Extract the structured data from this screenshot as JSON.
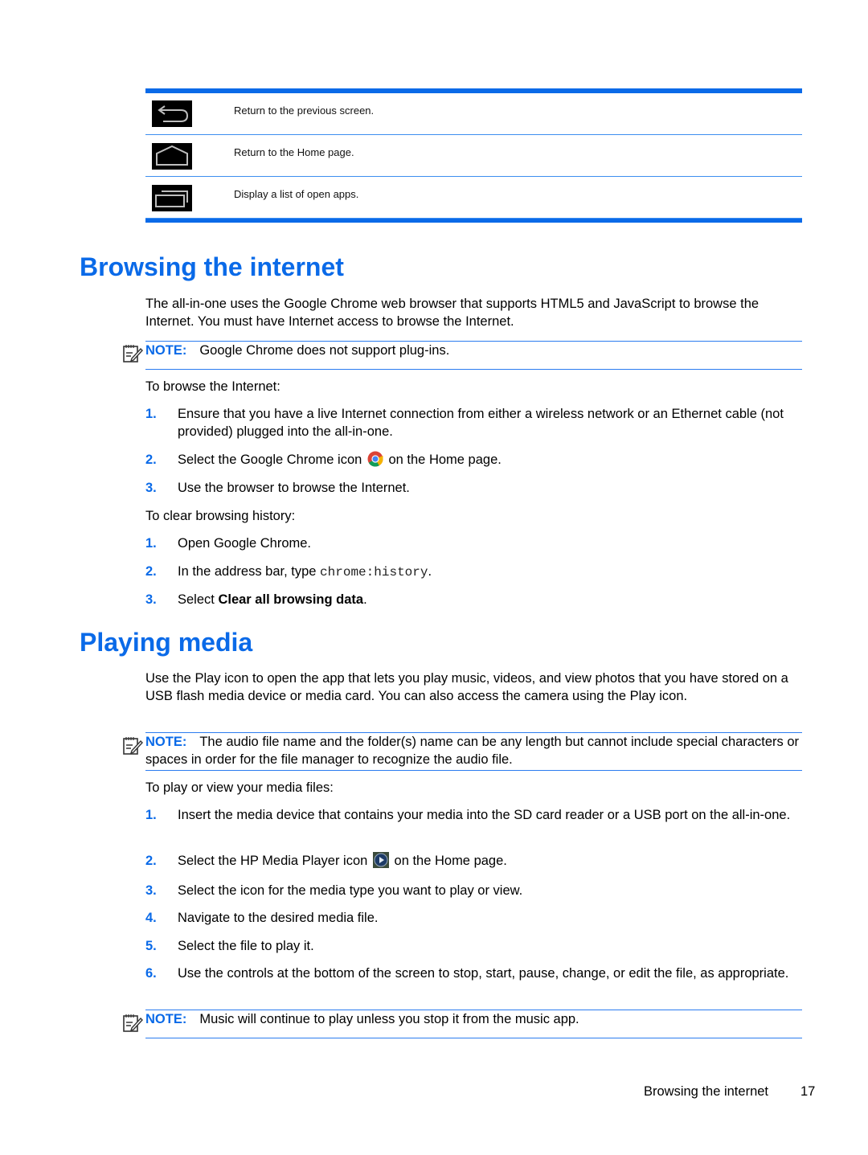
{
  "nav_table": {
    "rows": [
      {
        "icon": "back-arrow-icon",
        "description": "Return to the previous screen."
      },
      {
        "icon": "home-icon",
        "description": "Return to the Home page."
      },
      {
        "icon": "recent-apps-icon",
        "description": "Display a list of open apps."
      }
    ]
  },
  "browsing": {
    "heading": "Browsing the internet",
    "intro": "The all-in-one uses the Google Chrome web browser that supports HTML5 and JavaScript to browse the Internet. You must have Internet access to browse the Internet.",
    "note": {
      "label": "NOTE:",
      "text": "Google Chrome does not support plug-ins."
    },
    "browse_lead": "To browse the Internet:",
    "browse_steps": [
      {
        "num": "1.",
        "text": "Ensure that you have a live Internet connection from either a wireless network or an Ethernet cable (not provided) plugged into the all-in-one."
      },
      {
        "num": "2.",
        "text_before": "Select the Google Chrome icon",
        "icon": "chrome-icon",
        "text_after": "on the Home page."
      },
      {
        "num": "3.",
        "text": "Use the browser to browse the Internet."
      }
    ],
    "clear_lead": "To clear browsing history:",
    "clear_steps": [
      {
        "num": "1.",
        "text": "Open Google Chrome."
      },
      {
        "num": "2.",
        "text_before": "In the address bar, type",
        "code": "chrome:history",
        "text_after": "."
      },
      {
        "num": "3.",
        "text_before": "Select",
        "bold": "Clear all browsing data",
        "text_after": "."
      }
    ]
  },
  "media": {
    "heading": "Playing media",
    "intro": "Use the Play icon to open the app that lets you play music, videos, and view photos that you have stored on a USB flash media device or media card. You can also access the camera using the Play icon.",
    "note1": {
      "label": "NOTE:",
      "text": "The audio file name and the folder(s) name can be any length but cannot include special characters or spaces in order for the file manager to recognize the audio file."
    },
    "lead": "To play or view your media files:",
    "steps": [
      {
        "num": "1.",
        "text": "Insert the media device that contains your media into the SD card reader or a USB port on the all-in-one."
      },
      {
        "num": "2.",
        "text_before": "Select the HP Media Player icon",
        "icon": "media-player-icon",
        "text_after": "on the Home page."
      },
      {
        "num": "3.",
        "text": "Select the icon for the media type you want to play or view."
      },
      {
        "num": "4.",
        "text": "Navigate to the desired media file."
      },
      {
        "num": "5.",
        "text": "Select the file to play it."
      },
      {
        "num": "6.",
        "text": "Use the controls at the bottom of the screen to stop, start, pause, change, or edit the file, as appropriate."
      }
    ],
    "note2": {
      "label": "NOTE:",
      "text": "Music will continue to play unless you stop it from the music app."
    }
  },
  "footer": {
    "section": "Browsing the internet",
    "page": "17"
  },
  "colors": {
    "accent": "#0a6ae8",
    "rule": "#2b7cf0"
  }
}
